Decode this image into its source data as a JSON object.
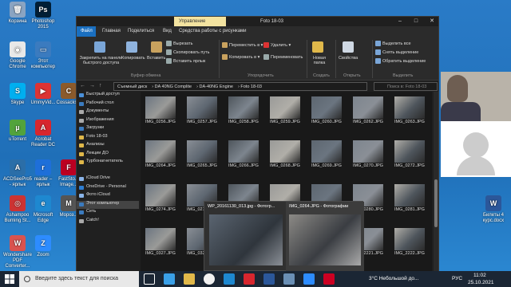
{
  "desktop": {
    "icons": [
      {
        "label": "Корзина",
        "color": "#8aa4c2",
        "glyph": "🗑"
      },
      {
        "label": "Google Chrome",
        "color": "#e8e8e8",
        "glyph": "◉"
      },
      {
        "label": "Skype",
        "color": "#00aff0",
        "glyph": "S"
      },
      {
        "label": "uTorrent",
        "color": "#52a33c",
        "glyph": "µ"
      },
      {
        "label": "ACDSeePro5 - ярлык",
        "color": "#2b6ea8",
        "glyph": "A"
      },
      {
        "label": "Ashampoo Burning St...",
        "color": "#c33",
        "glyph": "◎"
      },
      {
        "label": "Wondershare PDF Converter...",
        "color": "#d9534f",
        "glyph": "W"
      },
      {
        "label": "Photoshop 2015",
        "color": "#001e36",
        "glyph": "Ps"
      },
      {
        "label": "Этот компьютер",
        "color": "#3b7bbf",
        "glyph": "▭"
      },
      {
        "label": "UmmyVid...",
        "color": "#d33",
        "glyph": "▶"
      },
      {
        "label": "Acrobat Reader DC",
        "color": "#d7262e",
        "glyph": "A"
      },
      {
        "label": "reader – ярлык",
        "color": "#1e6fd9",
        "glyph": "r"
      },
      {
        "label": "Microsoft Edge",
        "color": "#1e88d0",
        "glyph": "e"
      },
      {
        "label": "Zoom",
        "color": "#2d8cff",
        "glyph": "Z"
      },
      {
        "label": "Cossacks...",
        "color": "#8b5a2b",
        "glyph": "C"
      },
      {
        "label": "FastSto... Image...",
        "color": "#b02",
        "glyph": "F"
      },
      {
        "label": "Мороз...",
        "color": "#555",
        "glyph": "M"
      },
      {
        "label": "Билеты 4 курс.docx",
        "color": "#2b579a",
        "glyph": "W"
      }
    ]
  },
  "window": {
    "title": "Foto 18-03",
    "manage_tab": "Управление",
    "tabs": [
      "Файл",
      "Главная",
      "Поделиться",
      "Вид",
      "Средства работы с рисунками"
    ],
    "controls": [
      "–",
      "□",
      "✕"
    ],
    "ribbon": {
      "pin_label": "Закрепить на панели быстрого доступа",
      "copy": "Копировать",
      "paste": "Вставить",
      "cut": "Вырезать",
      "copy_path": "Скопировать путь",
      "paste_shortcut": "Вставить ярлык",
      "clipboard_group": "Буфер обмена",
      "move_to": "Переместить в ▾",
      "copy_to": "Копировать в ▾",
      "delete": "Удалить ▾",
      "rename": "Переименовать",
      "organize_group": "Упорядочить",
      "new_folder": "Новая папка",
      "create_group": "Создать",
      "properties": "Свойства",
      "open_group": "Открыть",
      "select_all": "Выделить все",
      "select_none": "Снять выделение",
      "invert": "Обратить выделение",
      "select_group": "Выделить"
    },
    "address": {
      "crumbs": [
        "Съемный диск",
        "DA 40NG Complite",
        "DA-40NG Engine",
        "Foto 18-03"
      ],
      "search_placeholder": "Поиск в: Foto 18-03"
    },
    "nav": [
      {
        "label": "Быстрый доступ",
        "color": "#4a90d9",
        "sel": false
      },
      {
        "label": "Рабочий стол",
        "color": "#3b7bbf",
        "sel": false
      },
      {
        "label": "Документы",
        "color": "#aaa",
        "sel": false
      },
      {
        "label": "Изображения",
        "color": "#aaa",
        "sel": false
      },
      {
        "label": "Загрузки",
        "color": "#3b7bbf",
        "sel": false
      },
      {
        "label": "Foto 18-03",
        "color": "#e0b84a",
        "sel": false
      },
      {
        "label": "Анализы",
        "color": "#e0b84a",
        "sel": false
      },
      {
        "label": "Лекции ДО",
        "color": "#e0b84a",
        "sel": false
      },
      {
        "label": "Турбонагнетатель",
        "color": "#e0b84a",
        "sel": false
      },
      {
        "label": "",
        "color": "transparent",
        "sel": false
      },
      {
        "label": "iCloud Drive",
        "color": "#8ab4e8",
        "sel": false
      },
      {
        "label": "OneDrive - Personal",
        "color": "#2e7dd1",
        "sel": false
      },
      {
        "label": "Фото iCloud",
        "color": "#8ab4e8",
        "sel": false
      },
      {
        "label": "Этот компьютер",
        "color": "#3b7bbf",
        "sel": true
      },
      {
        "label": "Сеть",
        "color": "#3b7bbf",
        "sel": false
      },
      {
        "label": "Catch!",
        "color": "#aaa",
        "sel": false
      }
    ],
    "files": [
      "IMG_0256.JPG",
      "IMG_0257.JPG",
      "IMG_0258.JPG",
      "IMG_0259.JPG",
      "IMG_0260.JPG",
      "IMG_0262.JPG",
      "IMG_0263.JPG",
      "IMG_0264.JPG",
      "IMG_0265.JPG",
      "IMG_0266.JPG",
      "IMG_0268.JPG",
      "IMG_0269.JPG",
      "IMG_0270.JPG",
      "IMG_0272.JPG",
      "IMG_0274.JPG",
      "IMG_0275.JPG",
      "IMG_0276.JPG",
      "IMG_0277.JPG",
      "IMG_0278.JPG",
      "IMG_0280.JPG",
      "IMG_0281.JPG",
      "IMG_0327.JPG",
      "IMG_0328.JPG",
      "",
      "",
      "IMG_2220.JPG",
      "IMG_2221.JPG",
      "IMG_2222.JPG"
    ]
  },
  "preview": {
    "items": [
      "WP_20161130_013.jpg - Фотогр...",
      "IMG_0264.JPG - Фотографии"
    ]
  },
  "taskbar": {
    "search_placeholder": "Введите здесь текст для поиска",
    "weather": "3°C Небольшой до...",
    "lang": "РУС",
    "time": "11:02",
    "date": "25.10.2021"
  }
}
